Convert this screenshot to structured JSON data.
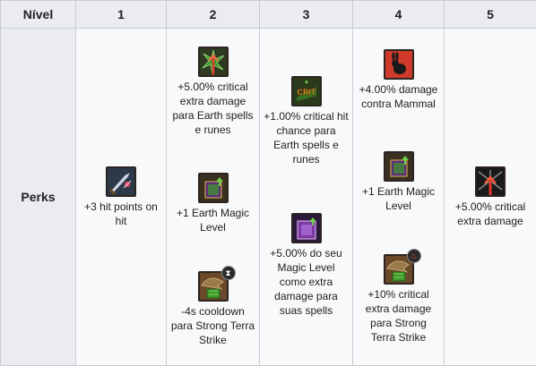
{
  "header": {
    "level_label": "Nível",
    "levels": [
      "1",
      "2",
      "3",
      "4",
      "5"
    ]
  },
  "row_label": "Perks",
  "perks": {
    "level1": [
      {
        "icon": "sword-icon",
        "text": "+3 hit points on hit"
      }
    ],
    "level2": [
      {
        "icon": "earth-crit-damage-icon",
        "text": "+5.00% critical extra damage para Earth spells e runes"
      },
      {
        "icon": "earth-magic-book-icon",
        "text": "+1 Earth Magic Level"
      },
      {
        "icon": "strong-terra-strike-icon",
        "badge": "cooldown-badge-icon",
        "text": "-4s cooldown para Strong Terra Strike"
      }
    ],
    "level3": [
      {
        "icon": "crit-chance-icon",
        "icon_label": "CRIT",
        "text": "+1.00% critical hit chance para Earth spells e runes"
      },
      {
        "icon": "magic-level-book-icon",
        "text": "+5.00% do seu Magic Level como extra damage para suas spells"
      }
    ],
    "level4": [
      {
        "icon": "rabbit-icon",
        "text": "+4.00% damage contra Mammal"
      },
      {
        "icon": "earth-magic-book-icon",
        "text": "+1 Earth Magic Level"
      },
      {
        "icon": "strong-terra-strike-icon",
        "badge": "damage-badge-icon",
        "text": "+10% critical extra damage para Strong Terra Strike"
      }
    ],
    "level5": [
      {
        "icon": "critical-damage-icon",
        "text": "+5.00% critical extra damage"
      }
    ]
  },
  "colors": {
    "header_bg": "#eaecf0",
    "cell_bg": "#f8f9fa",
    "border": "#c8ccd1",
    "text": "#202122",
    "earth_green": "#3f9a2c",
    "book_purple": "#5a2d7a",
    "crit_red": "#d43a2a"
  }
}
